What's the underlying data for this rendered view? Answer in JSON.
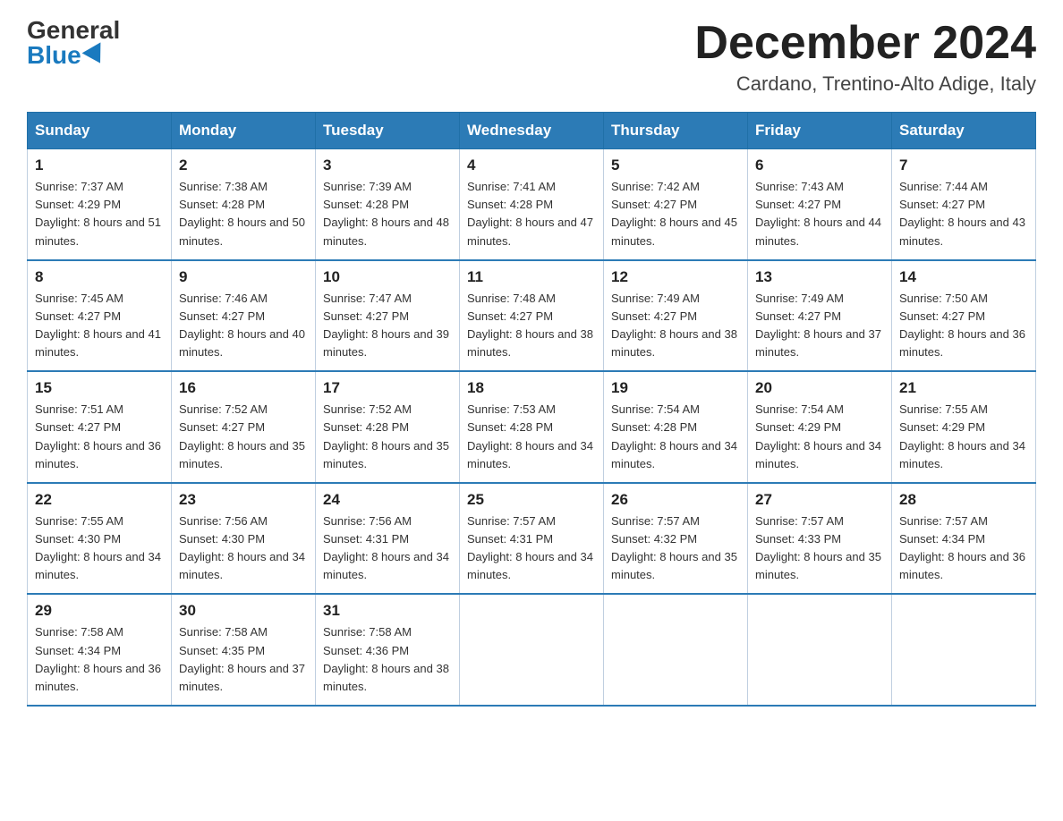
{
  "header": {
    "logo_general": "General",
    "logo_blue": "Blue",
    "month_title": "December 2024",
    "location": "Cardano, Trentino-Alto Adige, Italy"
  },
  "weekdays": [
    "Sunday",
    "Monday",
    "Tuesday",
    "Wednesday",
    "Thursday",
    "Friday",
    "Saturday"
  ],
  "weeks": [
    [
      {
        "day": "1",
        "sunrise": "7:37 AM",
        "sunset": "4:29 PM",
        "daylight": "8 hours and 51 minutes."
      },
      {
        "day": "2",
        "sunrise": "7:38 AM",
        "sunset": "4:28 PM",
        "daylight": "8 hours and 50 minutes."
      },
      {
        "day": "3",
        "sunrise": "7:39 AM",
        "sunset": "4:28 PM",
        "daylight": "8 hours and 48 minutes."
      },
      {
        "day": "4",
        "sunrise": "7:41 AM",
        "sunset": "4:28 PM",
        "daylight": "8 hours and 47 minutes."
      },
      {
        "day": "5",
        "sunrise": "7:42 AM",
        "sunset": "4:27 PM",
        "daylight": "8 hours and 45 minutes."
      },
      {
        "day": "6",
        "sunrise": "7:43 AM",
        "sunset": "4:27 PM",
        "daylight": "8 hours and 44 minutes."
      },
      {
        "day": "7",
        "sunrise": "7:44 AM",
        "sunset": "4:27 PM",
        "daylight": "8 hours and 43 minutes."
      }
    ],
    [
      {
        "day": "8",
        "sunrise": "7:45 AM",
        "sunset": "4:27 PM",
        "daylight": "8 hours and 41 minutes."
      },
      {
        "day": "9",
        "sunrise": "7:46 AM",
        "sunset": "4:27 PM",
        "daylight": "8 hours and 40 minutes."
      },
      {
        "day": "10",
        "sunrise": "7:47 AM",
        "sunset": "4:27 PM",
        "daylight": "8 hours and 39 minutes."
      },
      {
        "day": "11",
        "sunrise": "7:48 AM",
        "sunset": "4:27 PM",
        "daylight": "8 hours and 38 minutes."
      },
      {
        "day": "12",
        "sunrise": "7:49 AM",
        "sunset": "4:27 PM",
        "daylight": "8 hours and 38 minutes."
      },
      {
        "day": "13",
        "sunrise": "7:49 AM",
        "sunset": "4:27 PM",
        "daylight": "8 hours and 37 minutes."
      },
      {
        "day": "14",
        "sunrise": "7:50 AM",
        "sunset": "4:27 PM",
        "daylight": "8 hours and 36 minutes."
      }
    ],
    [
      {
        "day": "15",
        "sunrise": "7:51 AM",
        "sunset": "4:27 PM",
        "daylight": "8 hours and 36 minutes."
      },
      {
        "day": "16",
        "sunrise": "7:52 AM",
        "sunset": "4:27 PM",
        "daylight": "8 hours and 35 minutes."
      },
      {
        "day": "17",
        "sunrise": "7:52 AM",
        "sunset": "4:28 PM",
        "daylight": "8 hours and 35 minutes."
      },
      {
        "day": "18",
        "sunrise": "7:53 AM",
        "sunset": "4:28 PM",
        "daylight": "8 hours and 34 minutes."
      },
      {
        "day": "19",
        "sunrise": "7:54 AM",
        "sunset": "4:28 PM",
        "daylight": "8 hours and 34 minutes."
      },
      {
        "day": "20",
        "sunrise": "7:54 AM",
        "sunset": "4:29 PM",
        "daylight": "8 hours and 34 minutes."
      },
      {
        "day": "21",
        "sunrise": "7:55 AM",
        "sunset": "4:29 PM",
        "daylight": "8 hours and 34 minutes."
      }
    ],
    [
      {
        "day": "22",
        "sunrise": "7:55 AM",
        "sunset": "4:30 PM",
        "daylight": "8 hours and 34 minutes."
      },
      {
        "day": "23",
        "sunrise": "7:56 AM",
        "sunset": "4:30 PM",
        "daylight": "8 hours and 34 minutes."
      },
      {
        "day": "24",
        "sunrise": "7:56 AM",
        "sunset": "4:31 PM",
        "daylight": "8 hours and 34 minutes."
      },
      {
        "day": "25",
        "sunrise": "7:57 AM",
        "sunset": "4:31 PM",
        "daylight": "8 hours and 34 minutes."
      },
      {
        "day": "26",
        "sunrise": "7:57 AM",
        "sunset": "4:32 PM",
        "daylight": "8 hours and 35 minutes."
      },
      {
        "day": "27",
        "sunrise": "7:57 AM",
        "sunset": "4:33 PM",
        "daylight": "8 hours and 35 minutes."
      },
      {
        "day": "28",
        "sunrise": "7:57 AM",
        "sunset": "4:34 PM",
        "daylight": "8 hours and 36 minutes."
      }
    ],
    [
      {
        "day": "29",
        "sunrise": "7:58 AM",
        "sunset": "4:34 PM",
        "daylight": "8 hours and 36 minutes."
      },
      {
        "day": "30",
        "sunrise": "7:58 AM",
        "sunset": "4:35 PM",
        "daylight": "8 hours and 37 minutes."
      },
      {
        "day": "31",
        "sunrise": "7:58 AM",
        "sunset": "4:36 PM",
        "daylight": "8 hours and 38 minutes."
      },
      null,
      null,
      null,
      null
    ]
  ]
}
